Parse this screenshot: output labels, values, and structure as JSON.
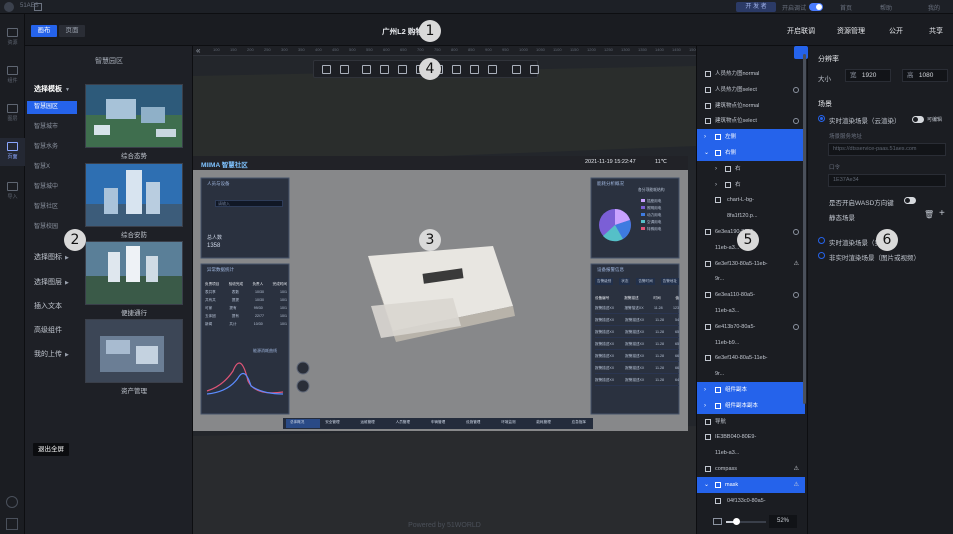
{
  "header": {
    "tabs": [
      "画布",
      "页面"
    ],
    "doc_title": "广州L2 购物中心",
    "actions": [
      "开启联调",
      "资源管理",
      "公开",
      "共享"
    ]
  },
  "template_panel": {
    "title": "智慧园区",
    "categories": [
      {
        "label": "选择模板",
        "expanded": true
      },
      {
        "label": "选择图标",
        "expanded": false
      },
      {
        "label": "选择图层",
        "expanded": false
      },
      {
        "label": "插入文本"
      },
      {
        "label": "高级组件"
      },
      {
        "label": "我的上传",
        "expanded": false
      }
    ],
    "subcategories": [
      "智慧园区",
      "智慧城市",
      "智慧水务",
      "智慧X",
      "智慧城中",
      "智慧社区",
      "智慧校园"
    ],
    "active_subcategory": "智慧园区",
    "thumbnails": [
      "综合态势",
      "综合安防",
      "便捷通行",
      "资产管理"
    ],
    "fullscreen_button": "退出全屏"
  },
  "canvas": {
    "ruler_ticks": [
      "100",
      "150",
      "200",
      "250",
      "300",
      "350",
      "400",
      "450",
      "500",
      "550",
      "600",
      "650",
      "700",
      "750",
      "800",
      "850",
      "900",
      "950",
      "1000",
      "1050",
      "1100",
      "1150",
      "1200",
      "1250",
      "1300",
      "1350",
      "1400",
      "1450",
      "1500"
    ],
    "toolbar_icons": [
      "redo-icon",
      "undo-icon",
      "align-left-icon",
      "align-center-icon",
      "align-right-icon",
      "align-top-icon",
      "align-middle-icon",
      "align-bottom-icon",
      "distribute-vertical-icon",
      "distribute-horizontal-icon",
      "settings-icon",
      "lock-icon"
    ],
    "footer": "Powered by 51WORLD",
    "dashboard": {
      "brand": "MIIMA 智慧社区",
      "datetime": "2021-11-19 15:22:47",
      "temp": "11℃",
      "left_card_title": "人员与设备",
      "search_placeholder": "请输入",
      "total_label": "总人数",
      "total_value": "1358",
      "left_table_title": "异常数据统计",
      "left_table_headers": [
        "负责项目",
        "验收完成",
        "负责人",
        "完成时间"
      ],
      "left_table_rows": [
        [
          "表共享",
          "表数",
          "10/30",
          "10/1"
        ],
        [
          "共有共",
          "提提",
          "10/30",
          "10/1"
        ],
        [
          "可家",
          "提有",
          "99/30",
          "10/1"
        ],
        [
          "五体团",
          "提有",
          "22/77",
          "10/1"
        ],
        [
          "新闻",
          "共计",
          "10/30",
          "10/1"
        ]
      ],
      "chart_label": "能源消耗曲线",
      "right_card_title": "能耗分析概况",
      "right_card_subtitle": "各分项能耗结构",
      "pie_legend": [
        "插座用电",
        "照明用电",
        "动力用电",
        "空调用电",
        "特殊用电"
      ],
      "right_table_title": "设备报警信息",
      "right_table_tabs": [
        "告警级别",
        "状态",
        "告警时间",
        "告警地址"
      ],
      "right_table_headers": [
        "设备编号",
        "报警描述",
        "时间",
        "值"
      ],
      "right_table_rows": [
        [
          "报警描述XX",
          "报警描述XX",
          "11.28",
          "123"
        ],
        [
          "报警描述XX",
          "报警描述XX",
          "11.28",
          "54"
        ],
        [
          "报警描述XX",
          "报警描述XX",
          "11.28",
          "65"
        ],
        [
          "报警描述XX",
          "报警描述XX",
          "11.28",
          "65"
        ],
        [
          "报警描述XX",
          "报警描述XX",
          "11.28",
          "66"
        ],
        [
          "报警描述XX",
          "报警描述XX",
          "11.28",
          "66"
        ],
        [
          "报警描述XX",
          "报警描述XX",
          "11.28",
          "64"
        ]
      ],
      "bottom_tabs": [
        "总体概况",
        "安全管理",
        "运维管理",
        "人员管理",
        "车辆管理",
        "设施管理",
        "环境监测",
        "能耗管理",
        "应急指挥"
      ]
    }
  },
  "layers": {
    "items": [
      {
        "label": "人员热力图normal",
        "icon": "image-icon",
        "eye": false
      },
      {
        "label": "人员热力图select",
        "icon": "image-icon",
        "eye": true
      },
      {
        "label": "建筑物点位normal",
        "icon": "image-icon",
        "eye": false
      },
      {
        "label": "建筑物点位select",
        "icon": "image-icon",
        "eye": true
      },
      {
        "label": "左侧",
        "icon": "group-icon",
        "selected": true,
        "chevron": "›"
      },
      {
        "label": "右侧",
        "icon": "group-icon",
        "selected": true,
        "chevron": "⌄"
      },
      {
        "label": "右",
        "icon": "group-icon",
        "indent": true,
        "chevron": "›"
      },
      {
        "label": "右",
        "icon": "group-icon",
        "indent": true,
        "chevron": "›"
      },
      {
        "label": "chart-L-bg-",
        "icon": "image-icon",
        "indent": true
      },
      {
        "label": "8fa1f120.p...",
        "icon": "",
        "indent": true
      },
      {
        "label": "6e3ea190-80a5-",
        "icon": "image-icon",
        "eye": true
      },
      {
        "label": "11eb-a3...",
        "icon": ""
      },
      {
        "label": "6e3ef130-80a5-11eb-",
        "icon": "image-icon",
        "warn": true
      },
      {
        "label": "9r...",
        "icon": ""
      },
      {
        "label": "6e3ea110-80a5-",
        "icon": "image-icon",
        "eye": true
      },
      {
        "label": "11eb-a3...",
        "icon": ""
      },
      {
        "label": "6e413b70-80a5-",
        "icon": "image-icon",
        "eye": true
      },
      {
        "label": "11eb-b9...",
        "icon": ""
      },
      {
        "label": "6e3ef140-80a5-11eb-",
        "icon": "image-icon"
      },
      {
        "label": "9r...",
        "icon": ""
      },
      {
        "label": "组件副本",
        "icon": "group-icon",
        "selected": true,
        "chevron": "›"
      },
      {
        "label": "组件副本副本",
        "icon": "group-icon",
        "selected": true,
        "chevron": "›"
      },
      {
        "label": "导航",
        "icon": "image-icon"
      },
      {
        "label": "IE3BB040-80E9-",
        "icon": "image-icon"
      },
      {
        "label": "11eb-a3...",
        "icon": ""
      },
      {
        "label": "compass",
        "icon": "image-icon",
        "warn": true
      },
      {
        "label": "mask",
        "icon": "group-icon",
        "selected": true,
        "warn": true,
        "chevron": "⌄"
      },
      {
        "label": "04f133c0-80a5-",
        "icon": "image-icon",
        "indent": true
      }
    ],
    "zoom": "52%"
  },
  "properties": {
    "resolution_title": "分辨率",
    "size_label": "大小",
    "width_label": "宽",
    "width_value": "1920",
    "height_label": "高",
    "height_value": "1080",
    "scene_title": "场景",
    "realtime_option": "实时渲染场景（云渲染）",
    "override_label": "可编辑",
    "scene_url_label": "场景服务地址",
    "scene_url_value": "https://dtsservice-paas.51aes.com",
    "token_label": "口令",
    "token_value": "1E37Ae34",
    "wasd_label": "是否开启WASD方向键",
    "static_scene_label": "静态场景",
    "realtime_option_2": "实时渲染场景（实时）",
    "non_realtime_option": "非实时渲染场景（图片或视频）"
  },
  "sysbar": {
    "app": "51AES",
    "pill": "开 发 者",
    "toggle_label": "开启调试",
    "links": [
      "首页",
      "帮助",
      "我的"
    ]
  },
  "rail": [
    "资源",
    "组件",
    "图层",
    "页面",
    "导入"
  ],
  "markers": [
    "1",
    "2",
    "3",
    "4",
    "5",
    "6"
  ]
}
